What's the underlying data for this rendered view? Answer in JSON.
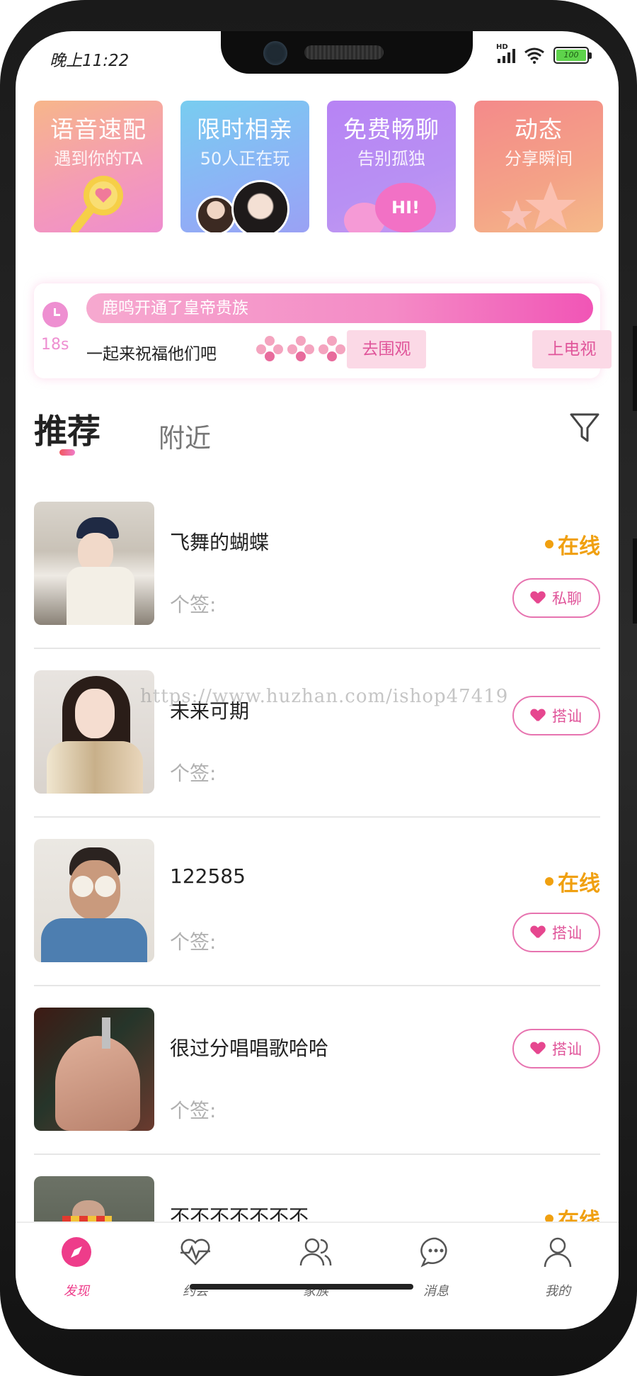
{
  "status_bar": {
    "time": "晚上11:22",
    "hd_label": "HD",
    "battery_level": "100"
  },
  "feature_cards": [
    {
      "title": "语音速配",
      "subtitle": "遇到你的TA"
    },
    {
      "title": "限时相亲",
      "subtitle": "50人正在玩"
    },
    {
      "title": "免费畅聊",
      "subtitle": "告别孤独",
      "bubble": "HI!"
    },
    {
      "title": "动态",
      "subtitle": "分享瞬间"
    }
  ],
  "broadcast": {
    "countdown": "18s",
    "banner": "鹿鸣开通了皇帝贵族",
    "message": "一起来祝福他们吧",
    "watch_button": "去围观",
    "tv_button": "上电视"
  },
  "tabs": {
    "recommend": "推荐",
    "nearby": "附近"
  },
  "users": [
    {
      "name": "飞舞的蝴蝶",
      "signature": "个签:",
      "online": "在线",
      "action": "私聊"
    },
    {
      "name": "未来可期",
      "signature": "个签:",
      "online": "",
      "action": "搭讪"
    },
    {
      "name": "122585",
      "signature": "个签:",
      "online": "在线",
      "action": "搭讪"
    },
    {
      "name": "很过分唱唱歌哈哈",
      "signature": "个签:",
      "online": "",
      "action": "搭讪"
    },
    {
      "name": "不不不不不不不",
      "signature": "",
      "online": "在线",
      "action": ""
    }
  ],
  "watermark": "https://www.huzhan.com/ishop47419",
  "bottom_nav": [
    {
      "label": "发现",
      "icon": "compass-icon",
      "active": true
    },
    {
      "label": "约会",
      "icon": "heartbeat-icon",
      "active": false
    },
    {
      "label": "家族",
      "icon": "group-icon",
      "active": false
    },
    {
      "label": "消息",
      "icon": "chat-bubble-icon",
      "active": false
    },
    {
      "label": "我的",
      "icon": "person-icon",
      "active": false
    }
  ],
  "colors": {
    "accent": "#ee3c8a",
    "online": "#f0a010",
    "button_border": "#e774b0"
  }
}
